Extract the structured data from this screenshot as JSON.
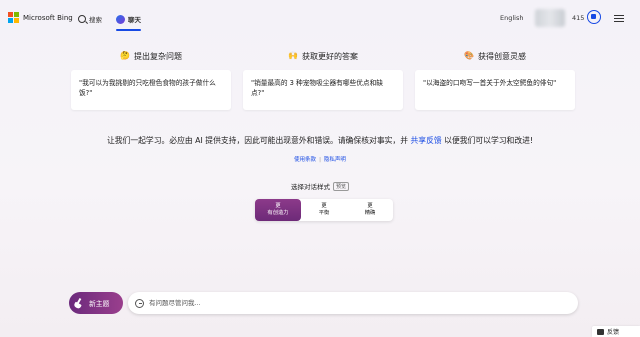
{
  "header": {
    "logo_text": "Microsoft Bing",
    "tabs": [
      {
        "label": "搜索"
      },
      {
        "label": "聊天"
      }
    ],
    "language": "English",
    "points": "415"
  },
  "columns": [
    {
      "heading": "提出复杂问题",
      "emoji": "🤔",
      "example": "\"我可以为我挑剔的只吃橙色食物的孩子做什么饭?\""
    },
    {
      "heading": "获取更好的答案",
      "emoji": "🙌",
      "example": "\"销量最高的 3 种宠物吸尘器有哪些优点和缺点?\""
    },
    {
      "heading": "获得创意灵感",
      "emoji": "🎨",
      "example": "\"以海盗的口吻写一首关于外太空鳄鱼的俳句\""
    }
  ],
  "notice": {
    "text": "让我们一起学习。必应由 AI 提供支持，因此可能出现意外和错误。请确保核对事实，并",
    "link": "共享反馈",
    "text_after": "以便我们可以学习和改进!"
  },
  "legal_links": [
    "使用条款",
    "隐私声明"
  ],
  "style_chooser": {
    "label": "选择对话样式",
    "preview_badge": "预览",
    "options": [
      {
        "line1": "更",
        "line2": "有创造力"
      },
      {
        "line1": "更",
        "line2": "平衡"
      },
      {
        "line1": "更",
        "line2": "精确"
      }
    ],
    "selected_index": 0
  },
  "input": {
    "new_topic_label": "新主题",
    "placeholder": "有问题尽管问我..."
  },
  "feedback_label": "反馈",
  "colors": {
    "accent": "#174ae4",
    "selected_style": "#7a2f80"
  }
}
